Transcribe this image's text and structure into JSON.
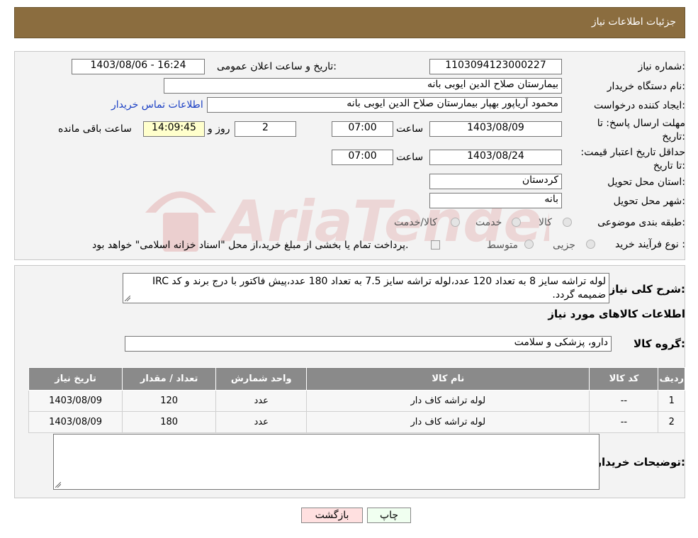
{
  "header": {
    "title": "جزئیات اطلاعات نیاز"
  },
  "form": {
    "need_number_label": "شماره نیاز:",
    "need_number": "1103094123000227",
    "announce_label": "تاریخ و ساعت اعلان عمومی:",
    "announce_value": "1403/08/06 - 16:24",
    "buyer_org_label": "نام دستگاه خریدار:",
    "buyer_org": "بیمارستان صلاح الدین ایوبی بانه",
    "creator_label": "ایجاد کننده درخواست:",
    "creator": "محمود آریاپور بهپار بیمارستان صلاح الدین ایوبی بانه",
    "contact_link": "اطلاعات تماس خریدار",
    "deadline_label": "مهلت ارسال پاسخ: تا تاریخ:",
    "deadline_date": "1403/08/09",
    "time_label": "ساعت",
    "deadline_time": "07:00",
    "days_value": "2",
    "days_label": "روز و",
    "remaining_time": "14:09:45",
    "remaining_label": "ساعت باقی مانده",
    "validity_label": "حداقل تاریخ اعتبار قیمت: تا تاریخ:",
    "validity_date": "1403/08/24",
    "validity_time": "07:00",
    "province_label": "استان محل تحویل:",
    "province": "کردستان",
    "city_label": "شهر محل تحویل:",
    "city": "بانه",
    "category_label": "طبقه بندی موضوعی:",
    "category_options": [
      "کالا",
      "خدمت",
      "کالا/خدمت"
    ],
    "process_label": "نوع فرآیند خرید :",
    "process_options": [
      "جزیی",
      "متوسط"
    ],
    "process_note": "پرداخت تمام یا بخشی از مبلغ خرید،از محل \"اسناد خزانه اسلامی\" خواهد بود."
  },
  "details": {
    "description_label": "شرح کلی نیاز:",
    "description": "لوله تراشه سایز 8 به تعداد 120 عدد،لوله تراشه سایز 7.5 به تعداد 180 عدد،پیش فاکتور با درج برند و کد IRC ضمیمه گردد.",
    "goods_info_title": "اطلاعات کالاهای مورد نیاز",
    "goods_group_label": "گروه کالا:",
    "goods_group": "دارو، پزشکی و سلامت",
    "table": {
      "headers": [
        "ردیف",
        "کد کالا",
        "نام کالا",
        "واحد شمارش",
        "تعداد / مقدار",
        "تاریخ نیاز"
      ],
      "rows": [
        [
          "1",
          "--",
          "لوله تراشه کاف دار",
          "عدد",
          "120",
          "1403/08/09"
        ],
        [
          "2",
          "--",
          "لوله تراشه کاف دار",
          "عدد",
          "180",
          "1403/08/09"
        ]
      ]
    },
    "buyer_notes_label": "توضیحات خریدار:",
    "buyer_notes": ""
  },
  "buttons": {
    "print": "چاپ",
    "back": "بازگشت"
  },
  "watermark": {
    "text": "AriaTender.neT"
  },
  "colors": {
    "header_bg": "#8b6d3f",
    "table_header": "#8a8a8a",
    "print_btn": "#f0fff0",
    "back_btn": "#ffe0e0",
    "link": "#1a3fc4"
  }
}
